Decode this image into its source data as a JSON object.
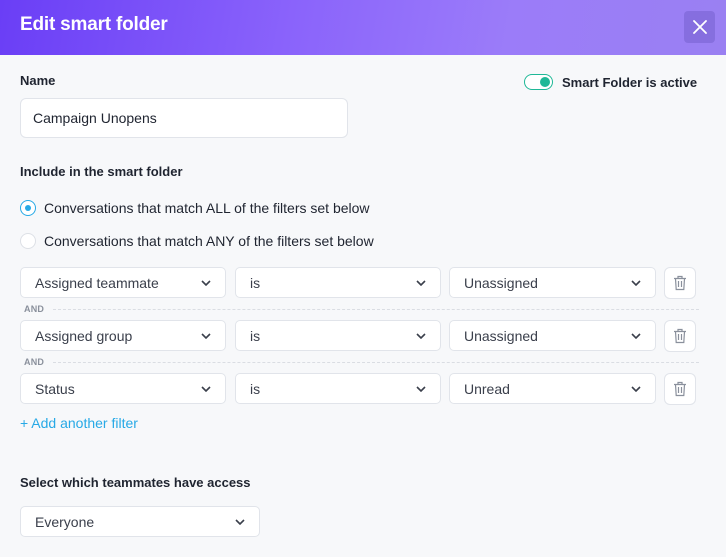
{
  "header": {
    "title": "Edit smart folder",
    "close_icon": "close-icon"
  },
  "name_field": {
    "label": "Name",
    "value": "Campaign Unopens"
  },
  "active_toggle": {
    "label": "Smart Folder is active",
    "on": true,
    "color": "#1fb897"
  },
  "include": {
    "label": "Include in the smart folder",
    "options": [
      {
        "label": "Conversations that match ALL of the filters set below",
        "checked": true
      },
      {
        "label": "Conversations that match ANY of the filters set below",
        "checked": false
      }
    ]
  },
  "filters": [
    {
      "field": "Assigned teammate",
      "operator": "is",
      "value": "Unassigned"
    },
    {
      "field": "Assigned group",
      "operator": "is",
      "value": "Unassigned"
    },
    {
      "field": "Status",
      "operator": "is",
      "value": "Unread"
    }
  ],
  "connector": "AND",
  "add_filter_label": "+ Add another filter",
  "access": {
    "label": "Select which teammates have access",
    "value": "Everyone"
  },
  "colors": {
    "accent": "#27a9e6",
    "header_gradient_start": "#6a3ef6",
    "header_gradient_end": "#9a80f2"
  }
}
